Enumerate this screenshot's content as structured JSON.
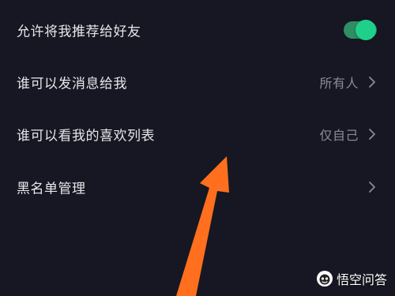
{
  "settings": {
    "items": [
      {
        "label": "允许将我推荐给好友",
        "value": "",
        "toggle_on": true
      },
      {
        "label": "谁可以发消息给我",
        "value": "所有人"
      },
      {
        "label": "谁可以看我的喜欢列表",
        "value": "仅自己"
      },
      {
        "label": "黑名单管理",
        "value": ""
      }
    ]
  },
  "annotation": {
    "arrow_color": "#FF6F1E",
    "icon": "arrow-up-icon"
  },
  "watermark": {
    "text": "悟空问答",
    "icon": "wukong-logo-icon"
  },
  "colors": {
    "background": "#161722",
    "toggle_track": "#2F8E64",
    "toggle_knob": "#1FD08B",
    "primary_text": "#E6E6EA",
    "secondary_text": "#8A8B95"
  }
}
